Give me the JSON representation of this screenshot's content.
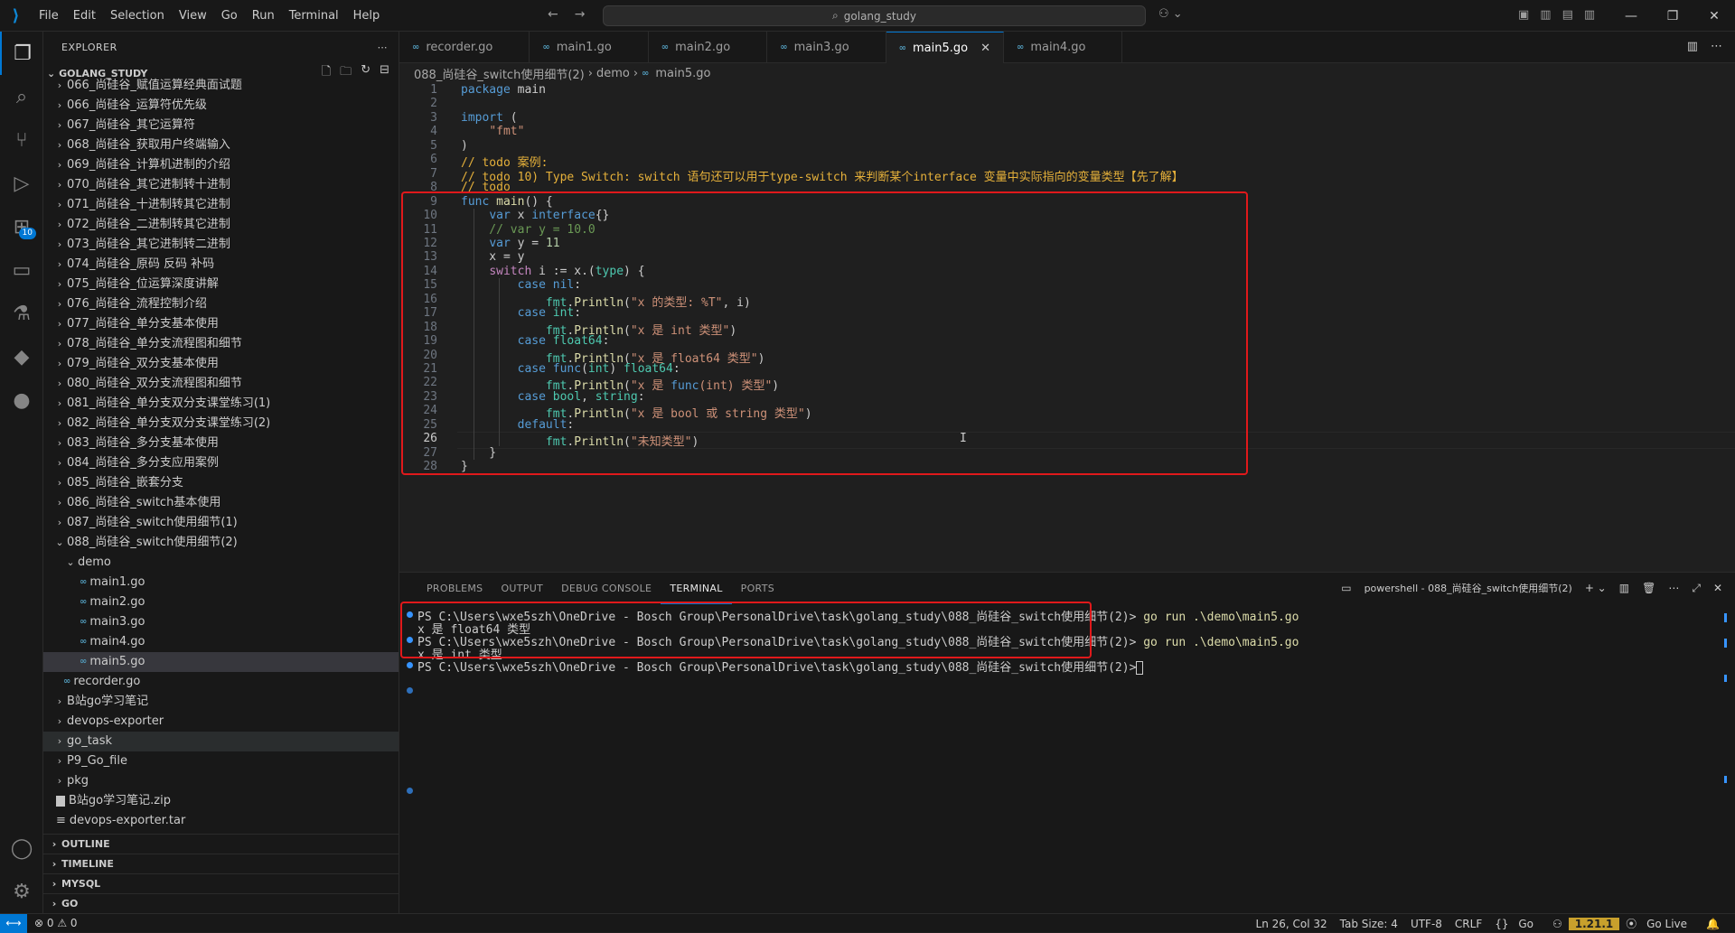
{
  "menu": [
    "File",
    "Edit",
    "Selection",
    "View",
    "Go",
    "Run",
    "Terminal",
    "Help"
  ],
  "command_center": "golang_study",
  "explorer": {
    "title": "EXPLORER",
    "root": "GOLANG_STUDY",
    "items": [
      "066_尚硅谷_赋值运算经典面试题",
      "066_尚硅谷_运算符优先级",
      "067_尚硅谷_其它运算符",
      "068_尚硅谷_获取用户终端输入",
      "069_尚硅谷_计算机进制的介绍",
      "070_尚硅谷_其它进制转十进制",
      "071_尚硅谷_十进制转其它进制",
      "072_尚硅谷_二进制转其它进制",
      "073_尚硅谷_其它进制转二进制",
      "074_尚硅谷_原码 反码 补码",
      "075_尚硅谷_位运算深度讲解",
      "076_尚硅谷_流程控制介绍",
      "077_尚硅谷_单分支基本使用",
      "078_尚硅谷_单分支流程图和细节",
      "079_尚硅谷_双分支基本使用",
      "080_尚硅谷_双分支流程图和细节",
      "081_尚硅谷_单分支双分支课堂练习(1)",
      "082_尚硅谷_单分支双分支课堂练习(2)",
      "083_尚硅谷_多分支基本使用",
      "084_尚硅谷_多分支应用案例",
      "085_尚硅谷_嵌套分支",
      "086_尚硅谷_switch基本使用",
      "087_尚硅谷_switch使用细节(1)",
      "088_尚硅谷_switch使用细节(2)"
    ],
    "demo_folder": "demo",
    "demo_files": [
      "main1.go",
      "main2.go",
      "main3.go",
      "main4.go",
      "main5.go"
    ],
    "recorder": "recorder.go",
    "after": [
      {
        "name": "B站go学习笔记",
        "type": "folder"
      },
      {
        "name": "devops-exporter",
        "type": "folder"
      },
      {
        "name": "go_task",
        "type": "folder"
      },
      {
        "name": "P9_Go_file",
        "type": "folder"
      },
      {
        "name": "pkg",
        "type": "folder"
      },
      {
        "name": "B站go学习笔记.zip",
        "type": "zip"
      },
      {
        "name": "devops-exporter.tar",
        "type": "tar"
      }
    ],
    "panels": [
      "OUTLINE",
      "TIMELINE",
      "MYSQL",
      "GO"
    ]
  },
  "tabs": [
    {
      "label": "recorder.go",
      "active": false
    },
    {
      "label": "main1.go",
      "active": false
    },
    {
      "label": "main2.go",
      "active": false
    },
    {
      "label": "main3.go",
      "active": false
    },
    {
      "label": "main5.go",
      "active": true
    },
    {
      "label": "main4.go",
      "active": false
    }
  ],
  "breadcrumb": [
    "088_尚硅谷_switch使用细节(2)",
    "demo",
    "main5.go"
  ],
  "code_lines": [
    "package main",
    "",
    "import (",
    "    \"fmt\"",
    ")",
    "// todo 案例:",
    "// todo 10) Type Switch: switch 语句还可以用于type-switch 来判断某个interface 变量中实际指向的变量类型【先了解】",
    "// todo",
    "func main() {",
    "    var x interface{}",
    "    // var y = 10.0",
    "    var y = 11",
    "    x = y",
    "    switch i := x.(type) {",
    "        case nil:",
    "            fmt.Println(\"x 的类型: %T\", i)",
    "        case int:",
    "            fmt.Println(\"x 是 int 类型\")",
    "        case float64:",
    "            fmt.Println(\"x 是 float64 类型\")",
    "        case func(int) float64:",
    "            fmt.Println(\"x 是 func(int) 类型\")",
    "        case bool, string:",
    "            fmt.Println(\"x 是 bool 或 string 类型\")",
    "        default:",
    "            fmt.Println(\"未知类型\")",
    "    }",
    "}"
  ],
  "line_numbers": [
    "1",
    "2",
    "3",
    "4",
    "5",
    "6",
    "7",
    "8",
    "9",
    "10",
    "11",
    "12",
    "13",
    "14",
    "15",
    "16",
    "17",
    "18",
    "19",
    "20",
    "21",
    "22",
    "23",
    "24",
    "25",
    "26",
    "27",
    "28"
  ],
  "panel": {
    "tabs": [
      "PROBLEMS",
      "OUTPUT",
      "DEBUG CONSOLE",
      "TERMINAL",
      "PORTS"
    ],
    "active_tab": "TERMINAL",
    "shell_label": "powershell - 088_尚硅谷_switch使用细节(2)",
    "prompt": "PS C:\\Users\\wxe5szh\\OneDrive - Bosch Group\\PersonalDrive\\task\\golang_study\\088_尚硅谷_switch使用细节(2)>",
    "command": "go run .\\demo\\main5.go",
    "output1": "x 是 float64 类型",
    "output2": "x 是 int 类型"
  },
  "status": {
    "errors": "0",
    "warnings": "0",
    "position": "Ln 26, Col 32",
    "tab_size": "Tab Size: 4",
    "encoding": "UTF-8",
    "eol": "CRLF",
    "language": "Go",
    "go_version": "1.21.1",
    "go_live": "Go Live"
  },
  "colors": {
    "accent": "#0078d4",
    "highlight_box": "#e0191b"
  }
}
